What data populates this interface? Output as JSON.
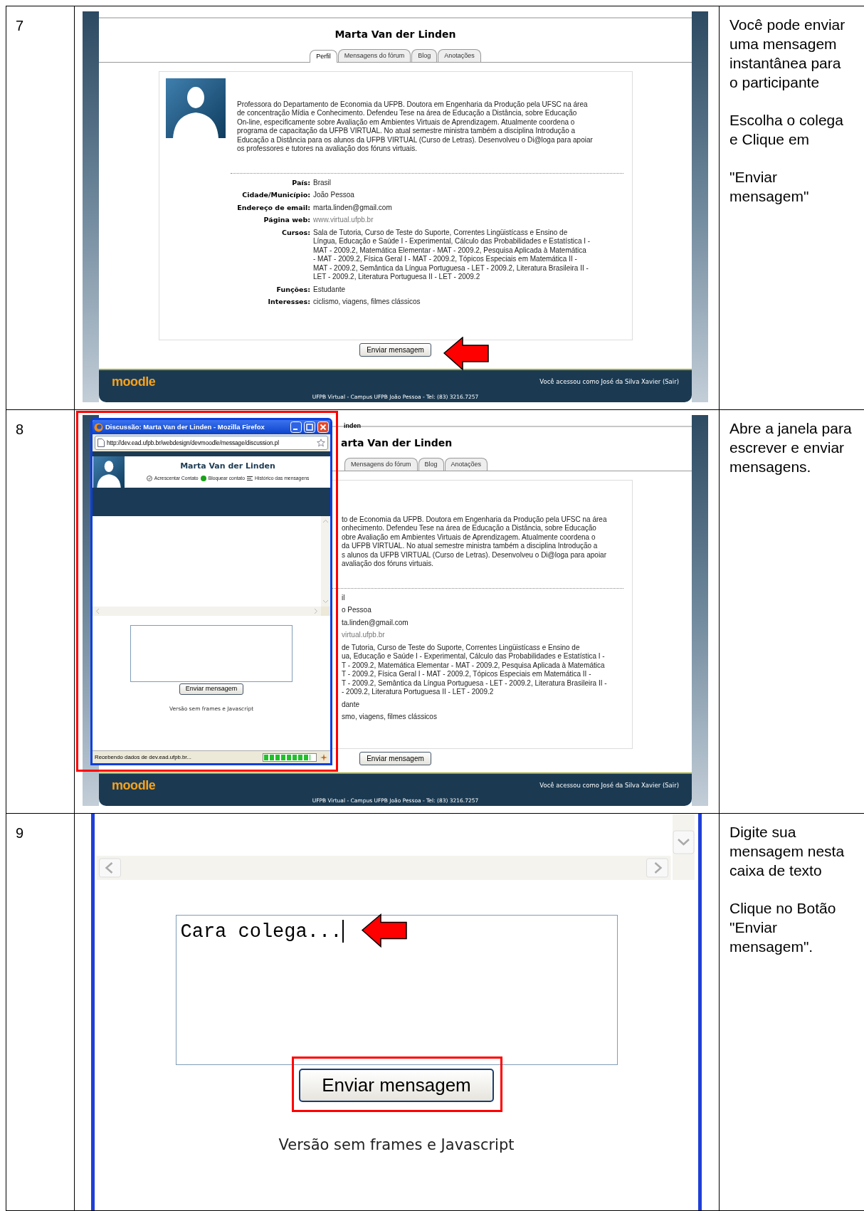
{
  "rows": [
    {
      "number": "7",
      "kind": "profile",
      "page": {
        "title": "Marta Van der Linden",
        "tabs": [
          {
            "label": "Perfil",
            "selected": true
          },
          {
            "label": "Mensagens do fórum",
            "selected": false
          },
          {
            "label": "Blog",
            "selected": false
          },
          {
            "label": "Anotações",
            "selected": false
          }
        ],
        "description": [
          "Professora do Departamento de Economia da UFPB. Doutora em Engenharia da Produção pela UFSC na área",
          "de concentração Mídia e Conhecimento. Defendeu Tese na área de Educação a Distância, sobre Educação",
          "On-line, especificamente sobre Avaliação em Ambientes Virtuais de Aprendizagem. Atualmente coordena o",
          "programa de capacitação da UFPB VIRTUAL. No atual semestre ministra também a disciplina Introdução a",
          "Educação a Distância para os alunos da UFPB VIRTUAL (Curso de Letras). Desenvolveu o Di@loga para apoiar",
          "os professores e tutores na avaliação dos fóruns virtuais."
        ],
        "fields": [
          {
            "label": "País:",
            "lines": [
              "Brasil"
            ],
            "link": false
          },
          {
            "label": "Cidade/Município:",
            "lines": [
              "João Pessoa"
            ],
            "link": false
          },
          {
            "label": "Endereço de email:",
            "lines": [
              "marta.linden@gmail.com"
            ],
            "link": false
          },
          {
            "label": "Página web:",
            "lines": [
              "www.virtual.ufpb.br"
            ],
            "link": true
          },
          {
            "label": "Cursos:",
            "lines": [
              "Sala de Tutoria, Curso de Teste do Suporte, Correntes Lingüistícass e Ensino de",
              "Língua, Educação e Saúde I - Experimental, Cálculo das Probabilidades e Estatística I -",
              "MAT - 2009.2, Matemática Elementar - MAT - 2009.2, Pesquisa Aplicada à Matemática",
              "- MAT - 2009.2, Física Geral I - MAT - 2009.2, Tópicos Especiais em Matemática II -",
              "MAT - 2009.2, Semântica da Língua Portuguesa - LET - 2009.2, Literatura Brasileira II -",
              "LET - 2009.2, Literatura Portuguesa II - LET - 2009.2"
            ],
            "link": false
          },
          {
            "label": "Funções:",
            "lines": [
              "Estudante"
            ],
            "link": false
          },
          {
            "label": "Interesses:",
            "lines": [
              "ciclismo, viagens, filmes clássicos"
            ],
            "link": false
          }
        ],
        "send_button": "Enviar mensagem",
        "footer": {
          "logo": "moodle",
          "login": "Você acessou como José da Silva Xavier (Sair)",
          "address": "UFPB Virtual - Campus UFPB João Pessoa - Tel: (83) 3216.7257"
        }
      },
      "instructions": [
        "Você pode enviar uma mensagem instantânea para o participante",
        "Escolha o colega e Clique em",
        "\"Enviar mensagem\""
      ]
    },
    {
      "number": "8",
      "kind": "popup",
      "page": {
        "window_title": "inden",
        "title": "arta Van der Linden",
        "tabs": [
          {
            "label": "Mensagens do fórum",
            "selected": false
          },
          {
            "label": "Blog",
            "selected": false
          },
          {
            "label": "Anotações",
            "selected": false
          }
        ],
        "description": [
          "to de Economia da UFPB. Doutora em Engenharia da Produção pela UFSC na área",
          "onhecimento. Defendeu Tese na área de Educação a Distância, sobre Educação",
          "obre Avaliação em Ambientes Virtuais de Aprendizagem. Atualmente coordena o",
          "da UFPB VIRTUAL. No atual semestre ministra também a disciplina Introdução a",
          "s alunos da UFPB VIRTUAL (Curso de Letras). Desenvolveu o Di@loga para apoiar",
          "avaliação dos fóruns virtuais."
        ],
        "values": [
          {
            "lines": [
              "il"
            ],
            "link": false
          },
          {
            "lines": [
              "o Pessoa"
            ],
            "link": false
          },
          {
            "lines": [
              "ta.linden@gmail.com"
            ],
            "link": false
          },
          {
            "lines": [
              "virtual.ufpb.br"
            ],
            "link": true
          },
          {
            "lines": [
              "de Tutoria, Curso de Teste do Suporte, Correntes Lingüistícass e Ensino de",
              "ua, Educação e Saúde I - Experimental, Cálculo das Probabilidades e Estatística I -",
              "T - 2009.2, Matemática Elementar - MAT - 2009.2, Pesquisa Aplicada à Matemática",
              "T - 2009.2, Física Geral I - MAT - 2009.2, Tópicos Especiais em Matemática II -",
              "T - 2009.2, Semântica da Língua Portuguesa - LET - 2009.2, Literatura Brasileira II -",
              "- 2009.2, Literatura Portuguesa II - LET - 2009.2"
            ],
            "link": false
          },
          {
            "lines": [
              "dante"
            ],
            "link": false
          },
          {
            "lines": [
              "smo, viagens, filmes clássicos"
            ],
            "link": false
          }
        ],
        "send_button": "Enviar mensagem",
        "footer": {
          "logo": "moodle",
          "login": "Você acessou como José da Silva Xavier (Sair)",
          "address": "UFPB Virtual - Campus UFPB João Pessoa - Tel: (83) 3216.7257"
        }
      },
      "popup": {
        "title": "Discussão: Marta Van der Linden - Mozilla Firefox",
        "url": "http://dev.ead.ufpb.br/webdesign/devmoodle/message/discussion.pl",
        "name": "Marta Van der Linden",
        "actions": [
          {
            "kind": "add",
            "label": "Acrescentar Contato"
          },
          {
            "kind": "block",
            "label": "Bloquear contato"
          },
          {
            "kind": "history",
            "label": "Histórico das mensagens"
          }
        ],
        "send_button": "Enviar mensagem",
        "footer_link": "Versão sem frames e Javascript",
        "status": "Recebendo dados de dev.ead.ufpb.br...",
        "progress": {
          "level": 0.9
        }
      },
      "instructions": [
        "Abre a janela para escrever e enviar mensagens."
      ]
    },
    {
      "number": "9",
      "kind": "zoom",
      "message_field": {
        "value": "Cara colega..."
      },
      "send_button": "Enviar mensagem",
      "footer_link": "Versão sem frames e Javascript",
      "instructions": [
        "Digite sua mensagem nesta caixa de texto",
        "Clique no Botão \"Enviar mensagem\"."
      ]
    }
  ]
}
